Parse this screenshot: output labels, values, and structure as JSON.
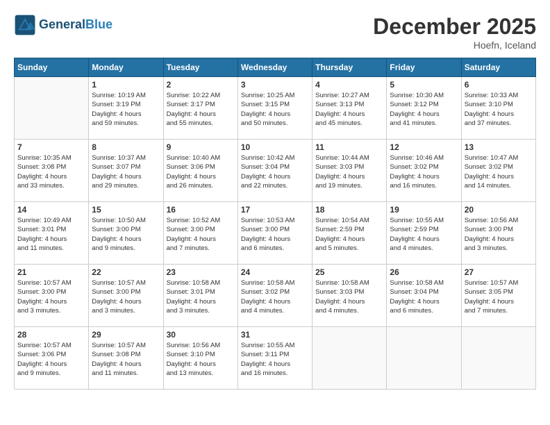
{
  "header": {
    "logo_line1": "General",
    "logo_line2": "Blue",
    "month": "December 2025",
    "location": "Hoefn, Iceland"
  },
  "weekdays": [
    "Sunday",
    "Monday",
    "Tuesday",
    "Wednesday",
    "Thursday",
    "Friday",
    "Saturday"
  ],
  "weeks": [
    [
      {
        "day": "",
        "info": ""
      },
      {
        "day": "1",
        "info": "Sunrise: 10:19 AM\nSunset: 3:19 PM\nDaylight: 4 hours\nand 59 minutes."
      },
      {
        "day": "2",
        "info": "Sunrise: 10:22 AM\nSunset: 3:17 PM\nDaylight: 4 hours\nand 55 minutes."
      },
      {
        "day": "3",
        "info": "Sunrise: 10:25 AM\nSunset: 3:15 PM\nDaylight: 4 hours\nand 50 minutes."
      },
      {
        "day": "4",
        "info": "Sunrise: 10:27 AM\nSunset: 3:13 PM\nDaylight: 4 hours\nand 45 minutes."
      },
      {
        "day": "5",
        "info": "Sunrise: 10:30 AM\nSunset: 3:12 PM\nDaylight: 4 hours\nand 41 minutes."
      },
      {
        "day": "6",
        "info": "Sunrise: 10:33 AM\nSunset: 3:10 PM\nDaylight: 4 hours\nand 37 minutes."
      }
    ],
    [
      {
        "day": "7",
        "info": "Sunrise: 10:35 AM\nSunset: 3:08 PM\nDaylight: 4 hours\nand 33 minutes."
      },
      {
        "day": "8",
        "info": "Sunrise: 10:37 AM\nSunset: 3:07 PM\nDaylight: 4 hours\nand 29 minutes."
      },
      {
        "day": "9",
        "info": "Sunrise: 10:40 AM\nSunset: 3:06 PM\nDaylight: 4 hours\nand 26 minutes."
      },
      {
        "day": "10",
        "info": "Sunrise: 10:42 AM\nSunset: 3:04 PM\nDaylight: 4 hours\nand 22 minutes."
      },
      {
        "day": "11",
        "info": "Sunrise: 10:44 AM\nSunset: 3:03 PM\nDaylight: 4 hours\nand 19 minutes."
      },
      {
        "day": "12",
        "info": "Sunrise: 10:46 AM\nSunset: 3:02 PM\nDaylight: 4 hours\nand 16 minutes."
      },
      {
        "day": "13",
        "info": "Sunrise: 10:47 AM\nSunset: 3:02 PM\nDaylight: 4 hours\nand 14 minutes."
      }
    ],
    [
      {
        "day": "14",
        "info": "Sunrise: 10:49 AM\nSunset: 3:01 PM\nDaylight: 4 hours\nand 11 minutes."
      },
      {
        "day": "15",
        "info": "Sunrise: 10:50 AM\nSunset: 3:00 PM\nDaylight: 4 hours\nand 9 minutes."
      },
      {
        "day": "16",
        "info": "Sunrise: 10:52 AM\nSunset: 3:00 PM\nDaylight: 4 hours\nand 7 minutes."
      },
      {
        "day": "17",
        "info": "Sunrise: 10:53 AM\nSunset: 3:00 PM\nDaylight: 4 hours\nand 6 minutes."
      },
      {
        "day": "18",
        "info": "Sunrise: 10:54 AM\nSunset: 2:59 PM\nDaylight: 4 hours\nand 5 minutes."
      },
      {
        "day": "19",
        "info": "Sunrise: 10:55 AM\nSunset: 2:59 PM\nDaylight: 4 hours\nand 4 minutes."
      },
      {
        "day": "20",
        "info": "Sunrise: 10:56 AM\nSunset: 3:00 PM\nDaylight: 4 hours\nand 3 minutes."
      }
    ],
    [
      {
        "day": "21",
        "info": "Sunrise: 10:57 AM\nSunset: 3:00 PM\nDaylight: 4 hours\nand 3 minutes."
      },
      {
        "day": "22",
        "info": "Sunrise: 10:57 AM\nSunset: 3:00 PM\nDaylight: 4 hours\nand 3 minutes."
      },
      {
        "day": "23",
        "info": "Sunrise: 10:58 AM\nSunset: 3:01 PM\nDaylight: 4 hours\nand 3 minutes."
      },
      {
        "day": "24",
        "info": "Sunrise: 10:58 AM\nSunset: 3:02 PM\nDaylight: 4 hours\nand 4 minutes."
      },
      {
        "day": "25",
        "info": "Sunrise: 10:58 AM\nSunset: 3:03 PM\nDaylight: 4 hours\nand 4 minutes."
      },
      {
        "day": "26",
        "info": "Sunrise: 10:58 AM\nSunset: 3:04 PM\nDaylight: 4 hours\nand 6 minutes."
      },
      {
        "day": "27",
        "info": "Sunrise: 10:57 AM\nSunset: 3:05 PM\nDaylight: 4 hours\nand 7 minutes."
      }
    ],
    [
      {
        "day": "28",
        "info": "Sunrise: 10:57 AM\nSunset: 3:06 PM\nDaylight: 4 hours\nand 9 minutes."
      },
      {
        "day": "29",
        "info": "Sunrise: 10:57 AM\nSunset: 3:08 PM\nDaylight: 4 hours\nand 11 minutes."
      },
      {
        "day": "30",
        "info": "Sunrise: 10:56 AM\nSunset: 3:10 PM\nDaylight: 4 hours\nand 13 minutes."
      },
      {
        "day": "31",
        "info": "Sunrise: 10:55 AM\nSunset: 3:11 PM\nDaylight: 4 hours\nand 16 minutes."
      },
      {
        "day": "",
        "info": ""
      },
      {
        "day": "",
        "info": ""
      },
      {
        "day": "",
        "info": ""
      }
    ]
  ]
}
